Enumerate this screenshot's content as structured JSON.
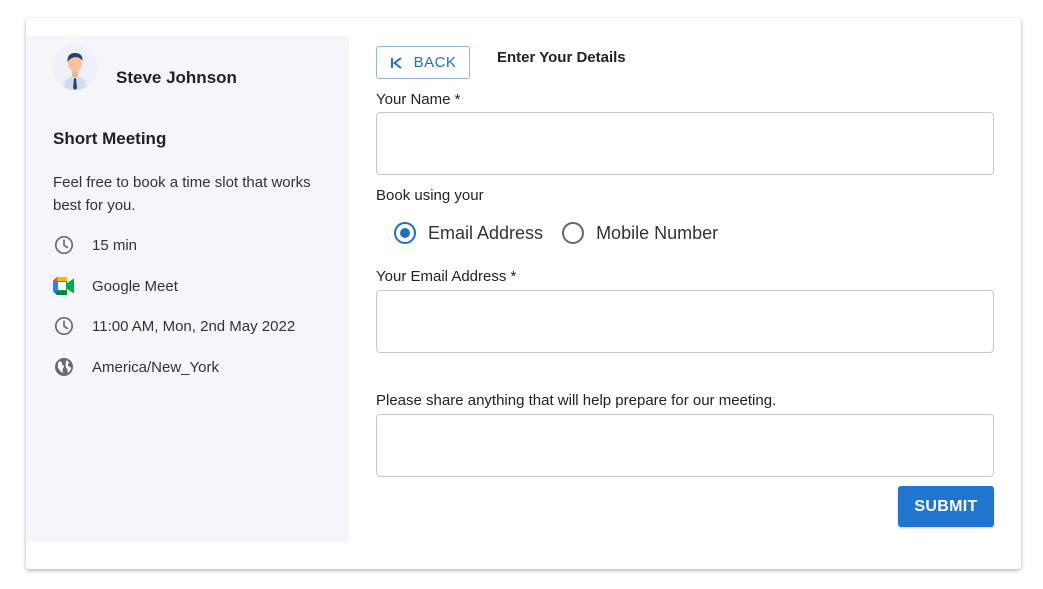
{
  "host": {
    "name": "Steve Johnson",
    "avatar_icon": "user-avatar-businessman"
  },
  "meeting": {
    "title": "Short Meeting",
    "description": "Feel free to book a time slot that works best for you.",
    "details": [
      {
        "icon": "clock-icon",
        "text": "15 min"
      },
      {
        "icon": "google-meet-icon",
        "text": "Google Meet"
      },
      {
        "icon": "clock-icon",
        "text": "11:00 AM, Mon, 2nd May 2022"
      },
      {
        "icon": "globe-icon",
        "text": "America/New_York"
      }
    ]
  },
  "form": {
    "back_label": "BACK",
    "section_title": "Enter Your Details",
    "name_label": "Your Name *",
    "name_value": "",
    "book_using_label": "Book using your",
    "radio_options": [
      {
        "label": "Email Address",
        "checked": true
      },
      {
        "label": "Mobile Number",
        "checked": false
      }
    ],
    "email_label": "Your Email Address *",
    "email_value": "",
    "notes_label": "Please share anything that will help prepare for our meeting.",
    "notes_value": "",
    "submit_label": "SUBMIT"
  },
  "colors": {
    "accent": "#1f75cf",
    "left_panel_bg": "#f5f6fa",
    "input_border": "#c7c7c7"
  }
}
